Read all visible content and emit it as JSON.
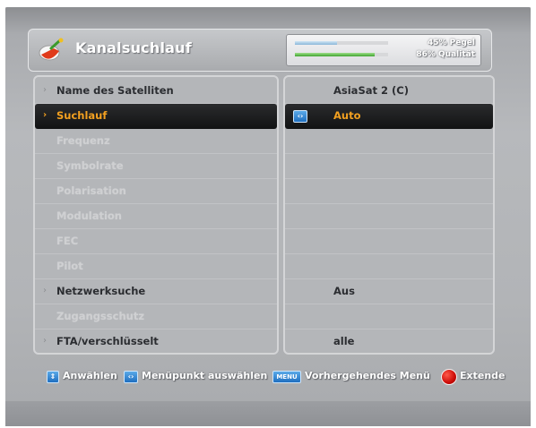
{
  "header": {
    "title": "Kanalsuchlauf",
    "app_icon": "satellite-dish-icon"
  },
  "signal": {
    "pegel_label": "45% Pegel",
    "quality_label": "86% Qualität",
    "pegel_level": 0.45,
    "quality_level": 0.86,
    "pegel_color": "#8ab6d8",
    "quality_color": "#3fa330"
  },
  "menu": {
    "items": [
      {
        "label": "Name des Satelliten",
        "disabled": false,
        "selected": false
      },
      {
        "label": "Suchlauf",
        "disabled": false,
        "selected": true
      },
      {
        "label": "Frequenz",
        "disabled": true,
        "selected": false
      },
      {
        "label": "Symbolrate",
        "disabled": true,
        "selected": false
      },
      {
        "label": "Polarisation",
        "disabled": true,
        "selected": false
      },
      {
        "label": "Modulation",
        "disabled": true,
        "selected": false
      },
      {
        "label": "FEC",
        "disabled": true,
        "selected": false
      },
      {
        "label": "Pilot",
        "disabled": true,
        "selected": false
      },
      {
        "label": "Netzwerksuche",
        "disabled": false,
        "selected": false
      },
      {
        "label": "Zugangsschutz",
        "disabled": true,
        "selected": false
      },
      {
        "label": "FTA/verschlüsselt",
        "disabled": false,
        "selected": false
      }
    ]
  },
  "values": {
    "items": [
      {
        "value": "AsiaSat 2 (C)"
      },
      {
        "value": "Auto",
        "selected": true
      },
      {
        "value": ""
      },
      {
        "value": ""
      },
      {
        "value": ""
      },
      {
        "value": ""
      },
      {
        "value": ""
      },
      {
        "value": ""
      },
      {
        "value": "Aus"
      },
      {
        "value": ""
      },
      {
        "value": "alle"
      }
    ]
  },
  "help": {
    "select_label": "Anwählen",
    "menu_item_label": "Menüpunkt auswählen",
    "menu_button": "MENU",
    "previous_menu_label": "Vorhergehendes Menü",
    "extended_label": "Extende",
    "accent_blue": "#1f6fc0",
    "accent_red": "#cc0c08",
    "selected_text_color": "#f2a020"
  }
}
